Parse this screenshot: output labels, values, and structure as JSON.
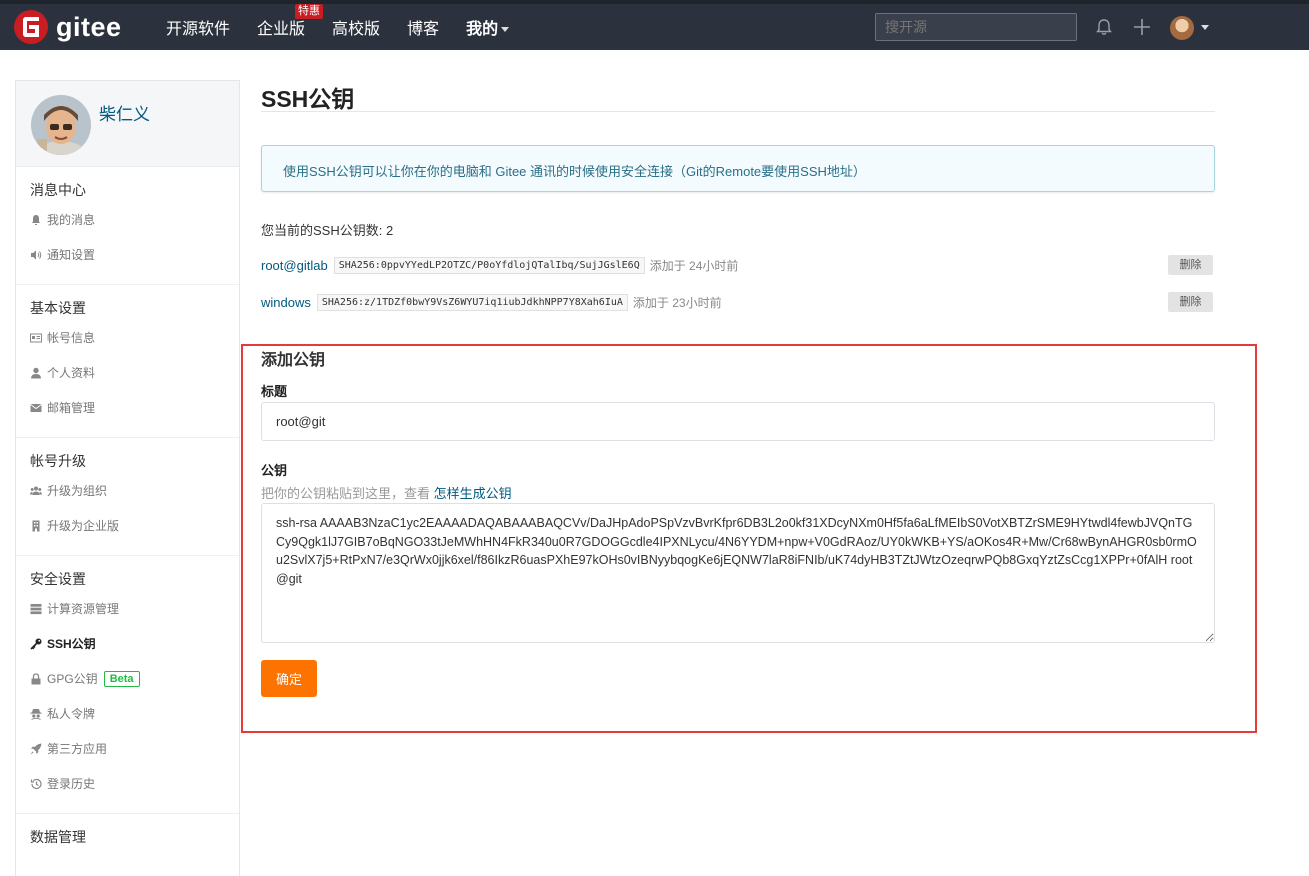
{
  "nav": {
    "brand": "gitee",
    "links": [
      "开源软件",
      "企业版",
      "高校版",
      "博客",
      "我的"
    ],
    "badge": "特惠",
    "search_placeholder": "搜开源"
  },
  "sidebar": {
    "username": "柴仁义",
    "groups": [
      {
        "title": "消息中心",
        "items": [
          {
            "icon": "bell-icon",
            "label": "我的消息"
          },
          {
            "icon": "speaker-icon",
            "label": "通知设置"
          }
        ]
      },
      {
        "title": "基本设置",
        "items": [
          {
            "icon": "id-card-icon",
            "label": "帐号信息"
          },
          {
            "icon": "user-icon",
            "label": "个人资料"
          },
          {
            "icon": "mail-icon",
            "label": "邮箱管理"
          }
        ]
      },
      {
        "title": "帐号升级",
        "items": [
          {
            "icon": "users-icon",
            "label": "升级为组织"
          },
          {
            "icon": "building-icon",
            "label": "升级为企业版"
          }
        ]
      },
      {
        "title": "安全设置",
        "items": [
          {
            "icon": "server-icon",
            "label": "计算资源管理"
          },
          {
            "icon": "key-icon",
            "label": "SSH公钥",
            "active": true
          },
          {
            "icon": "lock-icon",
            "label": "GPG公钥",
            "badge": "Beta"
          },
          {
            "icon": "spy-icon",
            "label": "私人令牌"
          },
          {
            "icon": "rocket-icon",
            "label": "第三方应用"
          },
          {
            "icon": "history-icon",
            "label": "登录历史"
          }
        ]
      },
      {
        "title": "数据管理",
        "items": []
      }
    ]
  },
  "main": {
    "title": "SSH公钥",
    "info": "使用SSH公钥可以让你在你的电脑和 Gitee 通讯的时候使用安全连接（Git的Remote要使用SSH地址）",
    "count_text": "您当前的SSH公钥数: 2",
    "keys": [
      {
        "name": "root@gitlab",
        "fingerprint": "SHA256:0ppvYYedLP2OTZC/P0oYfdlojQTalIbq/SujJGslE6Q",
        "added": "添加于 24小时前",
        "delete": "删除"
      },
      {
        "name": "windows",
        "fingerprint": "SHA256:z/1TDZf0bwY9VsZ6WYU7iq1iubJdkhNPP7Y8Xah6IuA",
        "added": "添加于 23小时前",
        "delete": "删除"
      }
    ],
    "add": {
      "heading": "添加公钥",
      "title_label": "标题",
      "title_value": "root@git",
      "key_label": "公钥",
      "hint": "把你的公钥粘贴到这里，查看 ",
      "hint_link": "怎样生成公钥",
      "key_value": "ssh-rsa AAAAB3NzaC1yc2EAAAADAQABAAABAQCVv/DaJHpAdoPSpVzvBvrKfpr6DB3L2o0kf31XDcyNXm0Hf5fa6aLfMEIbS0VotXBTZrSME9HYtwdl4fewbJVQnTGCy9Qgk1lJ7GIB7oBqNGO33tJeMWhHN4FkR340u0R7GDOGGcdle4IPXNLycu/4N6YYDM+npw+V0GdRAoz/UY0kWKB+YS/aOKos4R+Mw/Cr68wBynAHGR0sb0rmOu2SvlX7j5+RtPxN7/e3QrWx0jjk6xel/f86IkzR6uasPXhE97kOHs0vIBNyybqogKe6jEQNW7laR8iFNIb/uK74dyHB3TZtJWtzOzeqrwPQb8GxqYztZsCcg1XPPr+0fAlH root@git",
      "submit": "确定"
    }
  },
  "colors": {
    "nav_bg": "#2c323d",
    "brand_red": "#c71d23",
    "link": "#005980",
    "submit": "#fe7300",
    "highlight": "#e33b3b"
  }
}
